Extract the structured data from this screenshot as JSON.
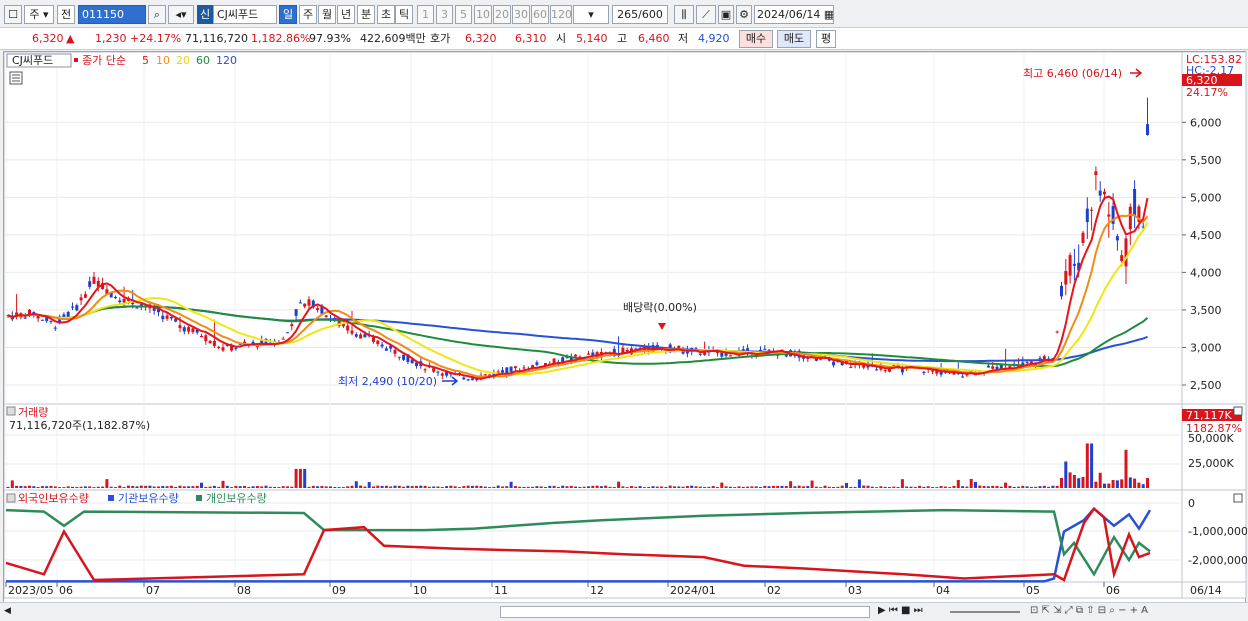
{
  "toolbar": {
    "type_label": "주",
    "prev_label": "전",
    "code_value": "011150",
    "badge_label": "신",
    "stock_name": "CJ씨푸드",
    "periods": [
      "일",
      "주",
      "월",
      "년",
      "분",
      "초",
      "틱"
    ],
    "multipliers": [
      "1",
      "3",
      "5",
      "10",
      "20",
      "30",
      "60",
      "120"
    ],
    "count_value": "265",
    "count_total": "/600",
    "date_value": "2024/06/14"
  },
  "info": {
    "price": "6,320",
    "arrow": "▲",
    "change": "1,230",
    "rate": "+24.17%",
    "volume": "71,116,720",
    "vol_rate": "1,182.86%",
    "ratio": "97.93%",
    "amount": "422,609백만",
    "ask_label": "호가",
    "ask1": "6,320",
    "ask2": "6,310",
    "open_label": "시",
    "open": "5,140",
    "high_label": "고",
    "high": "6,460",
    "low_label": "저",
    "low": "4,920",
    "buy_label": "매수",
    "sell_label": "매도",
    "eval_label": "평"
  },
  "legend": {
    "name": "CJ씨푸드",
    "series_label": "종가 단순",
    "mas": [
      "5",
      "10",
      "20",
      "60",
      "120"
    ]
  },
  "colors": {
    "up": "#d8141c",
    "down": "#1f3fd0",
    "ma5": "#e8141c",
    "ma10": "#f08c14",
    "ma20": "#f0e614",
    "ma60": "#1e8c3c",
    "ma120": "#2850d8",
    "foreign": "#d8141c",
    "institution": "#2850d8",
    "individual": "#2e8c5a"
  },
  "price_panel": {
    "corner_top": "LC:153.82",
    "corner_bottom": "HC:-2.17",
    "current_tag": "6,320",
    "current_rate": "24.17%",
    "yticks": [
      "6,000",
      "5,500",
      "5,000",
      "4,500",
      "4,000",
      "3,500",
      "3,000",
      "2,500"
    ],
    "high_note": "최고 6,460 (06/14)",
    "low_note": "최저 2,490 (10/20)",
    "dividend_note": "배당락(0.00%)"
  },
  "volume_panel": {
    "title": "거래량",
    "value": "71,116,720주(1,182.87%)",
    "tag": "71,117K",
    "tag_rate": "1182.87%",
    "yticks": [
      "50,000K",
      "25,000K"
    ]
  },
  "holdings_panel": {
    "title_foreign": "외국인보유수량",
    "title_inst": "기관보유수량",
    "title_indiv": "개인보유수량",
    "yticks": [
      "0",
      "-1,000,000",
      "-2,000,000"
    ]
  },
  "xaxis": {
    "labels": [
      "2023/05",
      "06",
      "07",
      "08",
      "09",
      "10",
      "11",
      "12",
      "2024/01",
      "02",
      "03",
      "04",
      "05",
      "06"
    ],
    "right_label": "06/14"
  },
  "chart_data": {
    "type": "candlestick",
    "ylim": [
      2300,
      6750
    ],
    "close_last": 6320,
    "high": 6460,
    "low": 2490,
    "volume_last": 71116720
  }
}
